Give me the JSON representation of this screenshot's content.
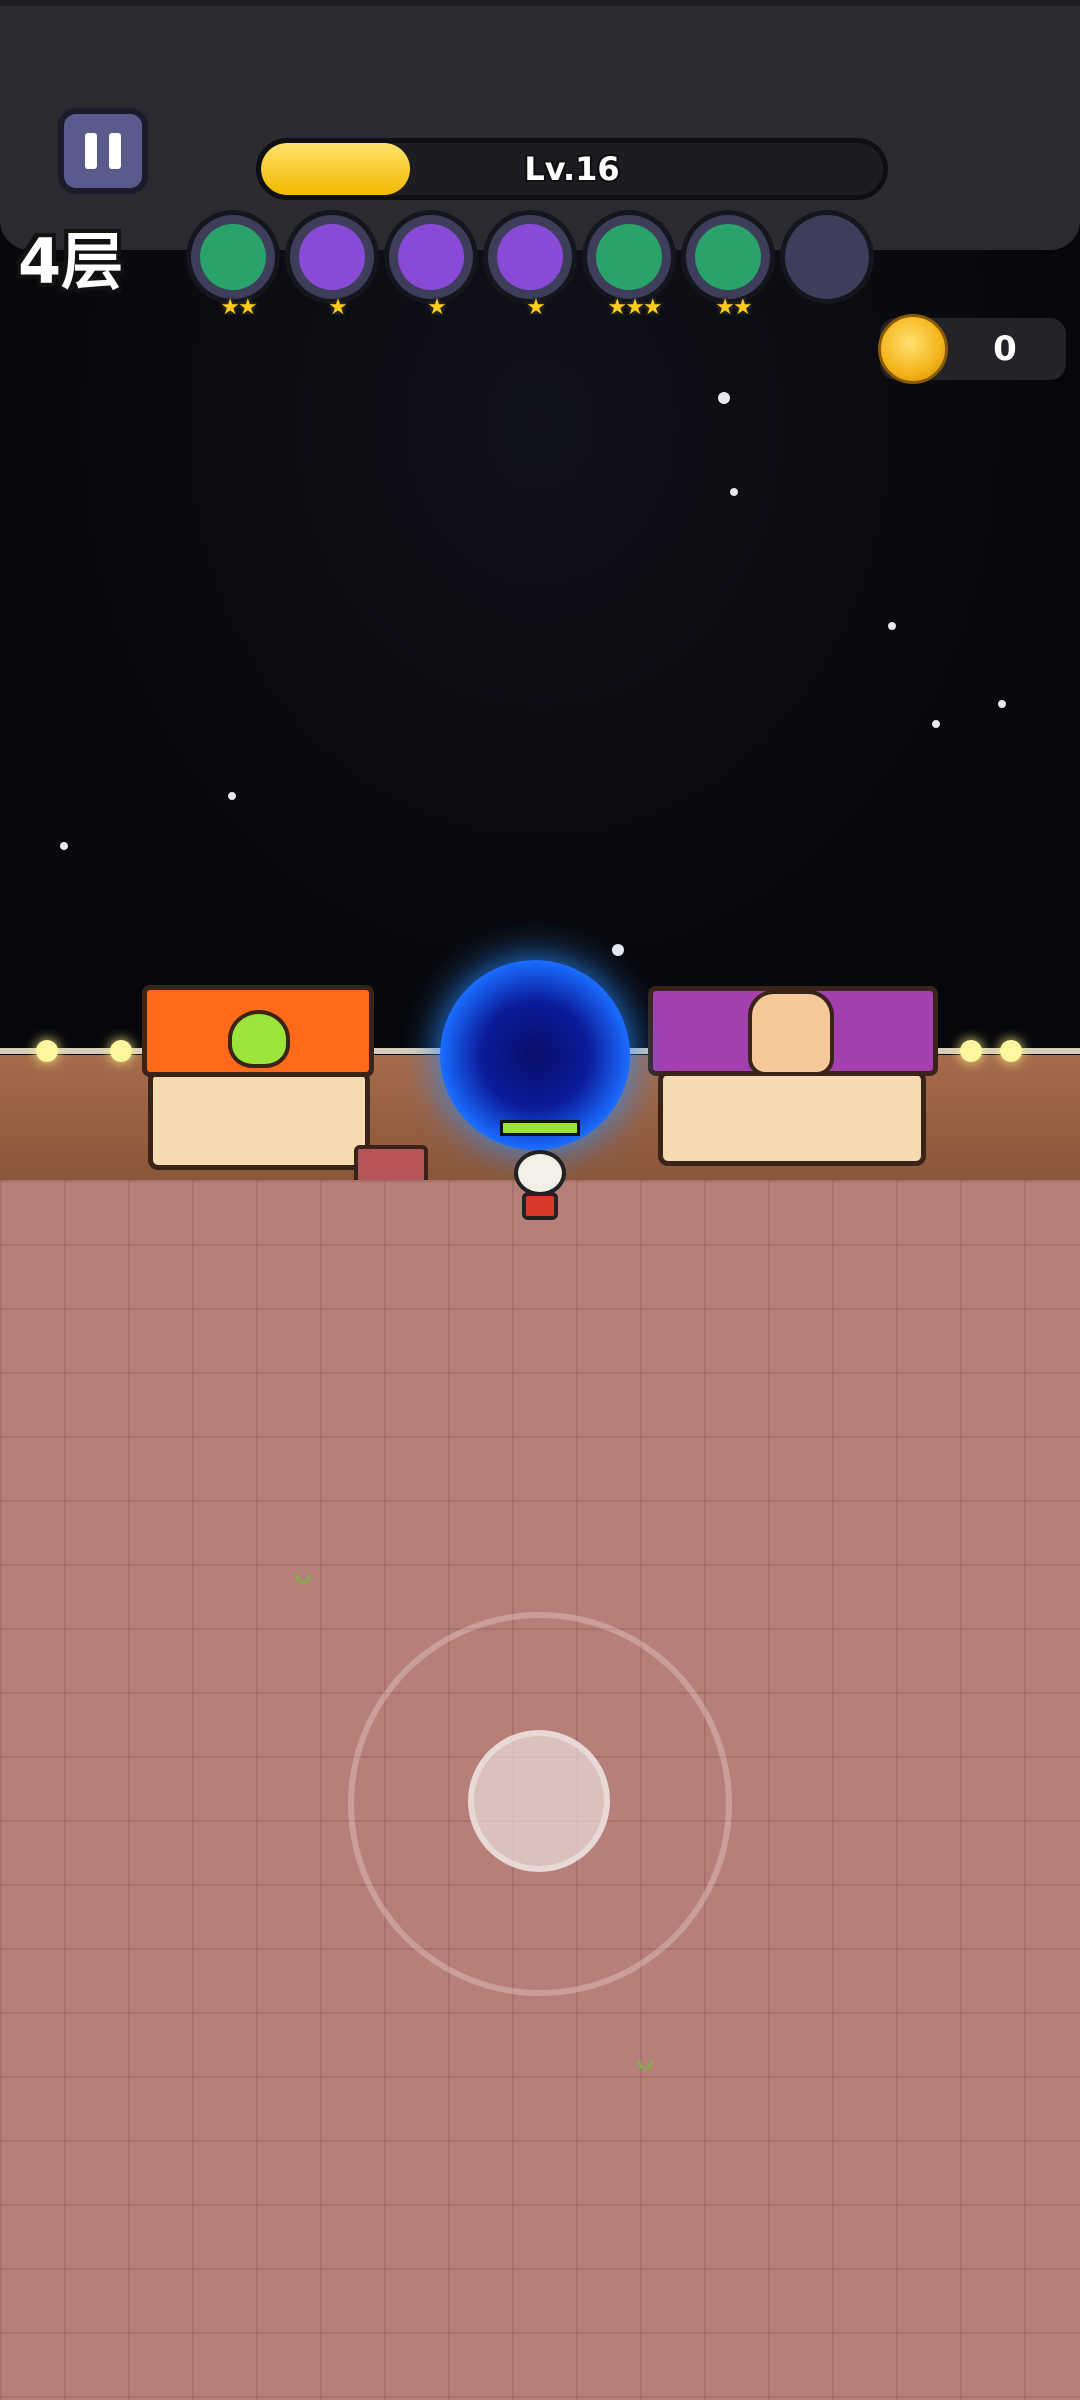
{
  "hud": {
    "floor_label": "4层",
    "level_text": "Lv.16",
    "xp_fraction": 0.24,
    "coins": "0"
  },
  "skills": [
    {
      "icon": "pistol-skill-icon",
      "color": "#2aa36a",
      "stars": 2
    },
    {
      "icon": "tornado-skill-icon",
      "color": "#8a4ad8",
      "stars": 1
    },
    {
      "icon": "boomerang-skill-icon",
      "color": "#8a4ad8",
      "stars": 1
    },
    {
      "icon": "monster-skill-icon",
      "color": "#8a4ad8",
      "stars": 1
    },
    {
      "icon": "binoculars-skill-icon",
      "color": "#2aa36a",
      "stars": 3
    },
    {
      "icon": "syringe-skill-icon",
      "color": "#2aa36a",
      "stars": 2
    },
    {
      "icon": "empty-skill-slot",
      "color": "#3e3e5a",
      "stars": 0
    }
  ],
  "colors": {
    "xp_fill": "#f3b800",
    "hp_fill": "#9be43a",
    "ground": "#b77f79",
    "portal": "#1a6cff",
    "left_awning": "#ff6a1a",
    "right_awning": "#a43fb0"
  },
  "player": {
    "hp_fraction": 1.0
  }
}
